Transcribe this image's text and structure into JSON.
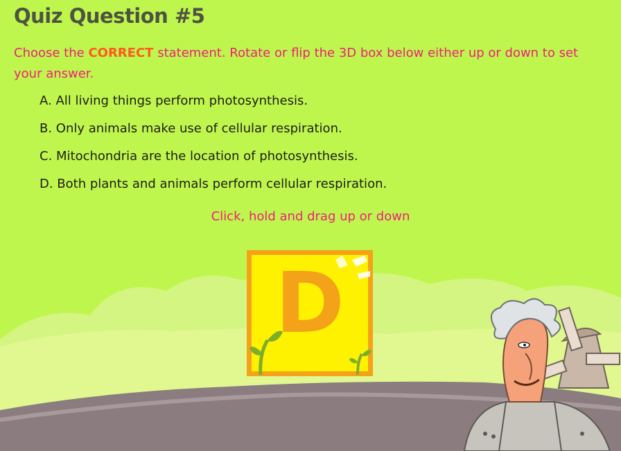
{
  "quiz": {
    "title": "Quiz Question #5",
    "prompt_before": "Choose the ",
    "prompt_highlight": "CORRECT",
    "prompt_after": " statement. Rotate or flip the 3D box below either up or down to set your answer.",
    "options": [
      "A. All living things perform photosynthesis.",
      "B. Only animals make use of cellular respiration.",
      "C. Mitochondria are the location of photosynthesis.",
      "D. Both plants and animals perform cellular respiration."
    ],
    "hint": "Click, hold and drag up or down",
    "selected_letter": "D"
  },
  "colors": {
    "background": "#bff64d",
    "title": "#4d5340",
    "prompt": "#ee1f7a",
    "highlight": "#ff5a1f",
    "box_fill": "#fff200",
    "box_border": "#f4a21a",
    "ground": "#8b7c80"
  },
  "icons": {
    "box_decoration": "sprout-icon",
    "character": "old-man-character",
    "background": "windmill-icon"
  }
}
